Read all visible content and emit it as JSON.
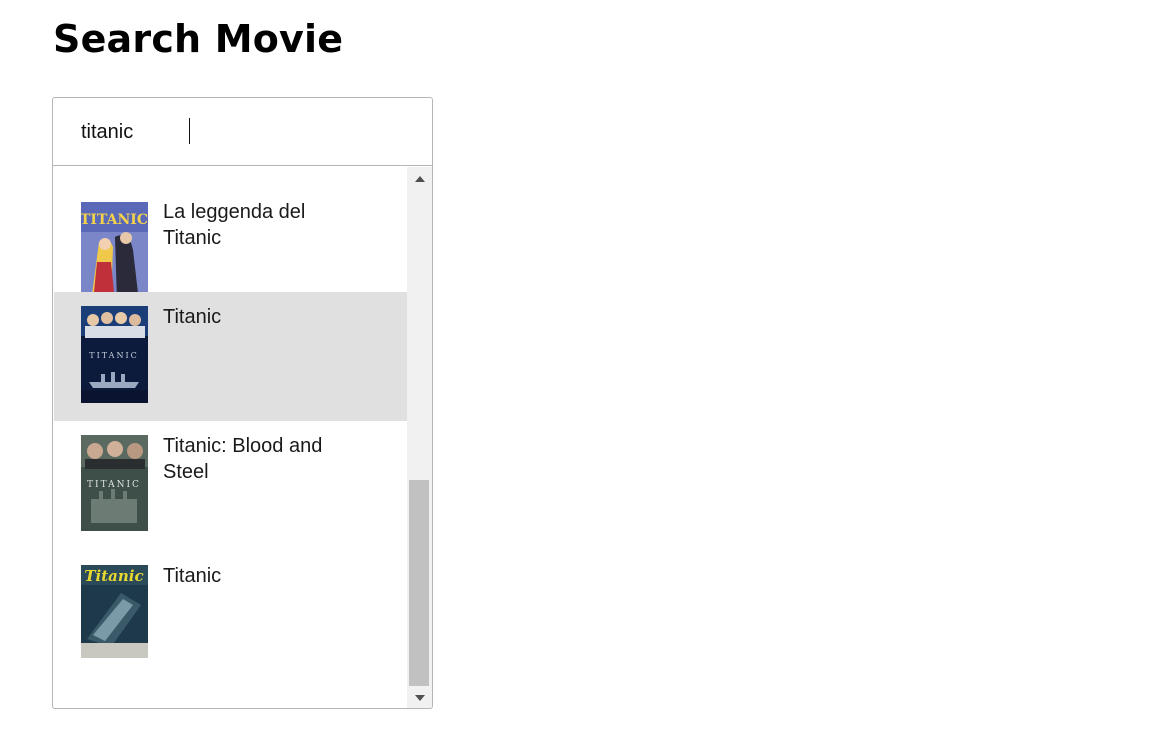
{
  "page": {
    "title": "Search Movie"
  },
  "search": {
    "value": "titanic",
    "placeholder": ""
  },
  "results": [
    {
      "title": "La leggenda del Titanic",
      "poster_icon": "movie-poster-icon",
      "highlighted": false
    },
    {
      "title": "Titanic",
      "poster_icon": "movie-poster-icon",
      "highlighted": true
    },
    {
      "title": "Titanic: Blood and Steel",
      "poster_icon": "movie-poster-icon",
      "highlighted": false
    },
    {
      "title": "Titanic",
      "poster_icon": "movie-poster-icon",
      "highlighted": false
    }
  ],
  "scroll": {
    "position": 0.85
  },
  "colors": {
    "highlight": "#e0e0e0",
    "border": "#b5b5b5",
    "scroll_track": "#f1f1f1",
    "scroll_thumb": "#c1c1c1"
  }
}
